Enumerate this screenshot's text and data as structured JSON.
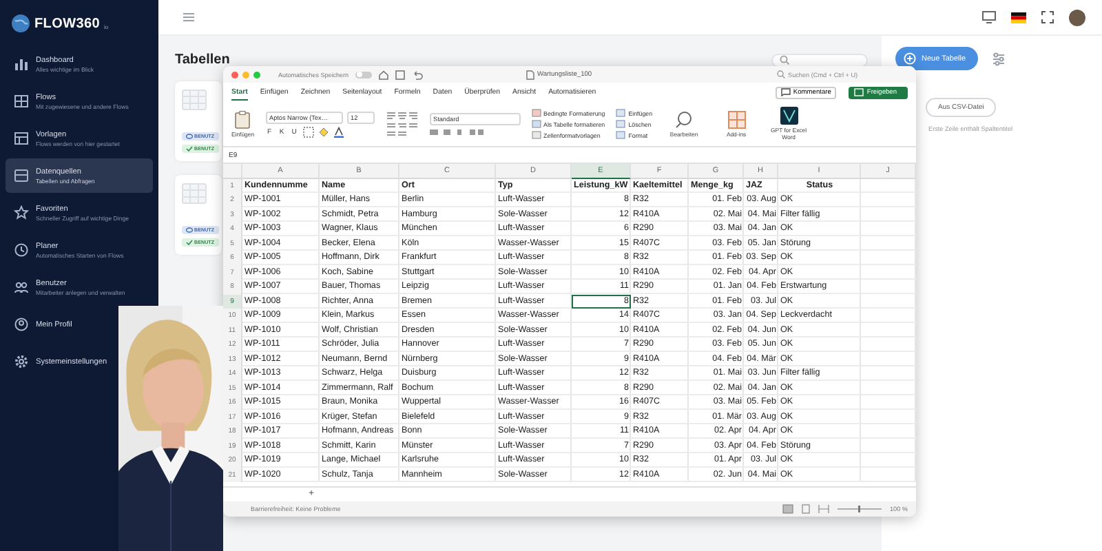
{
  "sidebar": {
    "logo": "FLOW360",
    "logo_suffix": "io",
    "items": [
      {
        "title": "Dashboard",
        "subtitle": "Alles wichtige im Blick",
        "kind": "chart",
        "selected": false
      },
      {
        "title": "Flows",
        "subtitle": "Mit zugewiesene und andere Flows",
        "kind": "flows",
        "selected": false
      },
      {
        "title": "Vorlagen",
        "subtitle": "Flows werden von hier gestartet",
        "kind": "template",
        "selected": false
      },
      {
        "title": "Datenquellen",
        "subtitle": "Tabellen und Abfragen",
        "kind": "table",
        "selected": true
      },
      {
        "title": "Favoriten",
        "subtitle": "Schneller Zugriff auf wichtige Dinge",
        "kind": "star",
        "selected": false
      },
      {
        "title": "Planer",
        "subtitle": "Automatisches Starten von Flows",
        "kind": "clock",
        "selected": false
      },
      {
        "title": "Benutzer",
        "subtitle": "Mitarbeiter anlegen und verwalten",
        "kind": "users",
        "selected": false
      },
      {
        "title": "Mein Profil",
        "kind": "profile",
        "selected": false
      },
      {
        "title": "Systemeinstellungen",
        "kind": "gear",
        "selected": false
      }
    ]
  },
  "page": {
    "title": "Tabellen",
    "cards": [
      {
        "badges": [
          {
            "kind": "info",
            "text": "BENUTZ"
          },
          {
            "kind": "success",
            "text": "BENUTZ"
          }
        ]
      },
      {
        "badges": [
          {
            "kind": "info",
            "text": "BENUTZ"
          },
          {
            "kind": "success",
            "text": "BENUTZ"
          }
        ]
      }
    ]
  },
  "right_panel": {
    "primary_button": "Neue Tabelle",
    "csv_button": "Aus CSV-Datei",
    "hint": "Erste Zeile enthält Spaltentitel"
  },
  "excel": {
    "autosave_label": "Automatisches Speichern",
    "autosave_on": false,
    "filename": "Wartungsliste_100",
    "search_placeholder": "Suchen (Cmd + Ctrl + U)",
    "tabs": [
      {
        "label": "Start",
        "selected": true
      },
      {
        "label": "Einfügen",
        "selected": false
      },
      {
        "label": "Zeichnen",
        "selected": false
      },
      {
        "label": "Seitenlayout",
        "selected": false
      },
      {
        "label": "Formeln",
        "selected": false
      },
      {
        "label": "Daten",
        "selected": false
      },
      {
        "label": "Überprüfen",
        "selected": false
      },
      {
        "label": "Ansicht",
        "selected": false
      },
      {
        "label": "Automatisieren",
        "selected": false
      }
    ],
    "comments_button": "Kommentare",
    "share_button": "Freigeben",
    "ribbon": {
      "paste_label": "Einfügen",
      "font": "Aptos Narrow (Tex…",
      "font_size": "12",
      "format_letters": [
        "F",
        "K",
        "U"
      ],
      "number_format": "Standard",
      "style_buttons": [
        "Bedingte Formatierung",
        "Als Tabelle formatieren",
        "Zellenformatvorlagen"
      ],
      "cell_buttons": [
        "Einfügen",
        "Löschen",
        "Format"
      ],
      "big_buttons": [
        {
          "kind": "search",
          "label": "Bearbeiten"
        },
        {
          "kind": "addins",
          "label": "Add-ins"
        },
        {
          "kind": "gpt",
          "label": "GPT for Excel Word"
        }
      ]
    },
    "name_box": "E9",
    "columns": [
      {
        "letter": "A",
        "selected": false
      },
      {
        "letter": "B",
        "selected": false
      },
      {
        "letter": "C",
        "selected": false
      },
      {
        "letter": "D",
        "selected": false
      },
      {
        "letter": "E",
        "selected": true
      },
      {
        "letter": "F",
        "selected": false
      },
      {
        "letter": "G",
        "selected": false
      },
      {
        "letter": "H",
        "selected": false
      },
      {
        "letter": "I",
        "selected": false
      },
      {
        "letter": "J",
        "selected": false
      }
    ],
    "rows": [
      {
        "num": "1",
        "kind": "header",
        "selected": false,
        "cells": [
          "Kundennumme",
          "Name",
          "Ort",
          "Typ",
          "Leistung_kW",
          "Kaeltemittel",
          "Menge_kg",
          "JAZ",
          "Status"
        ]
      },
      {
        "num": "2",
        "kind": "data",
        "selected": false,
        "cells": [
          "WP-1001",
          "Müller, Hans",
          "Berlin",
          "Luft-Wasser",
          "8",
          "R32",
          "01. Feb",
          "03. Aug",
          "OK"
        ]
      },
      {
        "num": "3",
        "kind": "data",
        "selected": false,
        "cells": [
          "WP-1002",
          "Schmidt, Petra",
          "Hamburg",
          "Sole-Wasser",
          "12",
          "R410A",
          "02. Mai",
          "04. Mai",
          "Filter fällig"
        ]
      },
      {
        "num": "4",
        "kind": "data",
        "selected": false,
        "cells": [
          "WP-1003",
          "Wagner, Klaus",
          "München",
          "Luft-Wasser",
          "6",
          "R290",
          "03. Mai",
          "04. Jan",
          "OK"
        ]
      },
      {
        "num": "5",
        "kind": "data",
        "selected": false,
        "cells": [
          "WP-1004",
          "Becker, Elena",
          "Köln",
          "Wasser-Wasser",
          "15",
          "R407C",
          "03. Feb",
          "05. Jan",
          "Störung"
        ]
      },
      {
        "num": "6",
        "kind": "data",
        "selected": false,
        "cells": [
          "WP-1005",
          "Hoffmann, Dirk",
          "Frankfurt",
          "Luft-Wasser",
          "8",
          "R32",
          "01. Feb",
          "03. Sep",
          "OK"
        ]
      },
      {
        "num": "7",
        "kind": "data",
        "selected": false,
        "cells": [
          "WP-1006",
          "Koch, Sabine",
          "Stuttgart",
          "Sole-Wasser",
          "10",
          "R410A",
          "02. Feb",
          "04. Apr",
          "OK"
        ]
      },
      {
        "num": "8",
        "kind": "data",
        "selected": false,
        "cells": [
          "WP-1007",
          "Bauer, Thomas",
          "Leipzig",
          "Luft-Wasser",
          "11",
          "R290",
          "01. Jan",
          "04. Feb",
          "Erstwartung"
        ]
      },
      {
        "num": "9",
        "kind": "data",
        "selected": true,
        "cells": [
          "WP-1008",
          "Richter, Anna",
          "Bremen",
          "Luft-Wasser",
          "8",
          "R32",
          "01. Feb",
          "03. Jul",
          "OK"
        ]
      },
      {
        "num": "10",
        "kind": "data",
        "selected": false,
        "cells": [
          "WP-1009",
          "Klein, Markus",
          "Essen",
          "Wasser-Wasser",
          "14",
          "R407C",
          "03. Jan",
          "04. Sep",
          "Leckverdacht"
        ]
      },
      {
        "num": "11",
        "kind": "data",
        "selected": false,
        "cells": [
          "WP-1010",
          "Wolf, Christian",
          "Dresden",
          "Sole-Wasser",
          "10",
          "R410A",
          "02. Feb",
          "04. Jun",
          "OK"
        ]
      },
      {
        "num": "12",
        "kind": "data",
        "selected": false,
        "cells": [
          "WP-1011",
          "Schröder, Julia",
          "Hannover",
          "Luft-Wasser",
          "7",
          "R290",
          "03. Feb",
          "05. Jun",
          "OK"
        ]
      },
      {
        "num": "13",
        "kind": "data",
        "selected": false,
        "cells": [
          "WP-1012",
          "Neumann, Bernd",
          "Nürnberg",
          "Sole-Wasser",
          "9",
          "R410A",
          "04. Feb",
          "04. Mär",
          "OK"
        ]
      },
      {
        "num": "14",
        "kind": "data",
        "selected": false,
        "cells": [
          "WP-1013",
          "Schwarz, Helga",
          "Duisburg",
          "Luft-Wasser",
          "12",
          "R32",
          "01. Mai",
          "03. Jun",
          "Filter fällig"
        ]
      },
      {
        "num": "15",
        "kind": "data",
        "selected": false,
        "cells": [
          "WP-1014",
          "Zimmermann, Ralf",
          "Bochum",
          "Luft-Wasser",
          "8",
          "R290",
          "02. Mai",
          "04. Jan",
          "OK"
        ]
      },
      {
        "num": "16",
        "kind": "data",
        "selected": false,
        "cells": [
          "WP-1015",
          "Braun, Monika",
          "Wuppertal",
          "Wasser-Wasser",
          "16",
          "R407C",
          "03. Mai",
          "05. Feb",
          "OK"
        ]
      },
      {
        "num": "17",
        "kind": "data",
        "selected": false,
        "cells": [
          "WP-1016",
          "Krüger, Stefan",
          "Bielefeld",
          "Luft-Wasser",
          "9",
          "R32",
          "01. Mär",
          "03. Aug",
          "OK"
        ]
      },
      {
        "num": "18",
        "kind": "data",
        "selected": false,
        "cells": [
          "WP-1017",
          "Hofmann, Andreas",
          "Bonn",
          "Sole-Wasser",
          "11",
          "R410A",
          "02. Apr",
          "04. Apr",
          "OK"
        ]
      },
      {
        "num": "19",
        "kind": "data",
        "selected": false,
        "cells": [
          "WP-1018",
          "Schmitt, Karin",
          "Münster",
          "Luft-Wasser",
          "7",
          "R290",
          "03. Apr",
          "04. Feb",
          "Störung"
        ]
      },
      {
        "num": "20",
        "kind": "data",
        "selected": false,
        "cells": [
          "WP-1019",
          "Lange, Michael",
          "Karlsruhe",
          "Luft-Wasser",
          "10",
          "R32",
          "01. Apr",
          "03. Jul",
          "OK"
        ]
      },
      {
        "num": "21",
        "kind": "data",
        "selected": false,
        "cells": [
          "WP-1020",
          "Schulz, Tanja",
          "Mannheim",
          "Sole-Wasser",
          "12",
          "R410A",
          "02. Jun",
          "04. Mai",
          "OK"
        ]
      }
    ],
    "add_sheet": "+",
    "status": "Barrierefreiheit: Keine Probleme",
    "zoom": "100 %"
  }
}
